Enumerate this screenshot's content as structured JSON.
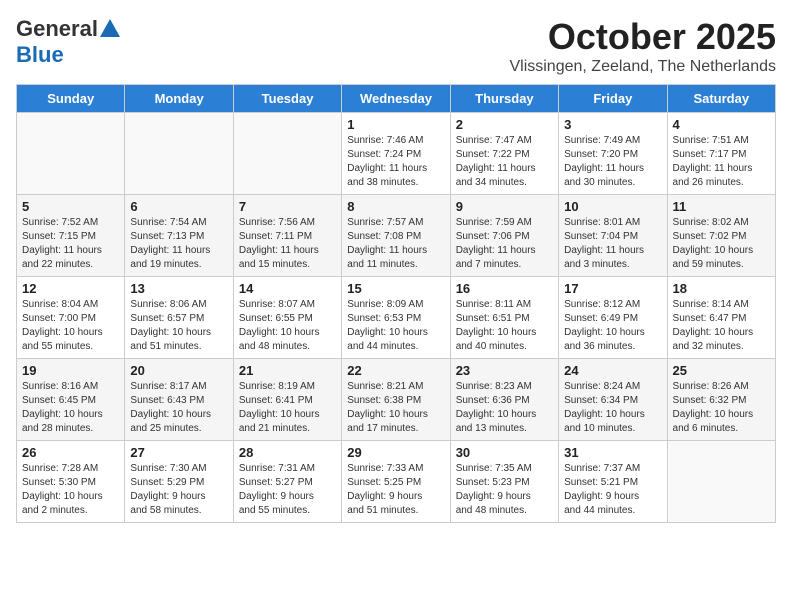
{
  "header": {
    "logo_general": "General",
    "logo_blue": "Blue",
    "month_title": "October 2025",
    "subtitle": "Vlissingen, Zeeland, The Netherlands"
  },
  "days_of_week": [
    "Sunday",
    "Monday",
    "Tuesday",
    "Wednesday",
    "Thursday",
    "Friday",
    "Saturday"
  ],
  "weeks": [
    [
      {
        "day": "",
        "info": ""
      },
      {
        "day": "",
        "info": ""
      },
      {
        "day": "",
        "info": ""
      },
      {
        "day": "1",
        "info": "Sunrise: 7:46 AM\nSunset: 7:24 PM\nDaylight: 11 hours\nand 38 minutes."
      },
      {
        "day": "2",
        "info": "Sunrise: 7:47 AM\nSunset: 7:22 PM\nDaylight: 11 hours\nand 34 minutes."
      },
      {
        "day": "3",
        "info": "Sunrise: 7:49 AM\nSunset: 7:20 PM\nDaylight: 11 hours\nand 30 minutes."
      },
      {
        "day": "4",
        "info": "Sunrise: 7:51 AM\nSunset: 7:17 PM\nDaylight: 11 hours\nand 26 minutes."
      }
    ],
    [
      {
        "day": "5",
        "info": "Sunrise: 7:52 AM\nSunset: 7:15 PM\nDaylight: 11 hours\nand 22 minutes."
      },
      {
        "day": "6",
        "info": "Sunrise: 7:54 AM\nSunset: 7:13 PM\nDaylight: 11 hours\nand 19 minutes."
      },
      {
        "day": "7",
        "info": "Sunrise: 7:56 AM\nSunset: 7:11 PM\nDaylight: 11 hours\nand 15 minutes."
      },
      {
        "day": "8",
        "info": "Sunrise: 7:57 AM\nSunset: 7:08 PM\nDaylight: 11 hours\nand 11 minutes."
      },
      {
        "day": "9",
        "info": "Sunrise: 7:59 AM\nSunset: 7:06 PM\nDaylight: 11 hours\nand 7 minutes."
      },
      {
        "day": "10",
        "info": "Sunrise: 8:01 AM\nSunset: 7:04 PM\nDaylight: 11 hours\nand 3 minutes."
      },
      {
        "day": "11",
        "info": "Sunrise: 8:02 AM\nSunset: 7:02 PM\nDaylight: 10 hours\nand 59 minutes."
      }
    ],
    [
      {
        "day": "12",
        "info": "Sunrise: 8:04 AM\nSunset: 7:00 PM\nDaylight: 10 hours\nand 55 minutes."
      },
      {
        "day": "13",
        "info": "Sunrise: 8:06 AM\nSunset: 6:57 PM\nDaylight: 10 hours\nand 51 minutes."
      },
      {
        "day": "14",
        "info": "Sunrise: 8:07 AM\nSunset: 6:55 PM\nDaylight: 10 hours\nand 48 minutes."
      },
      {
        "day": "15",
        "info": "Sunrise: 8:09 AM\nSunset: 6:53 PM\nDaylight: 10 hours\nand 44 minutes."
      },
      {
        "day": "16",
        "info": "Sunrise: 8:11 AM\nSunset: 6:51 PM\nDaylight: 10 hours\nand 40 minutes."
      },
      {
        "day": "17",
        "info": "Sunrise: 8:12 AM\nSunset: 6:49 PM\nDaylight: 10 hours\nand 36 minutes."
      },
      {
        "day": "18",
        "info": "Sunrise: 8:14 AM\nSunset: 6:47 PM\nDaylight: 10 hours\nand 32 minutes."
      }
    ],
    [
      {
        "day": "19",
        "info": "Sunrise: 8:16 AM\nSunset: 6:45 PM\nDaylight: 10 hours\nand 28 minutes."
      },
      {
        "day": "20",
        "info": "Sunrise: 8:17 AM\nSunset: 6:43 PM\nDaylight: 10 hours\nand 25 minutes."
      },
      {
        "day": "21",
        "info": "Sunrise: 8:19 AM\nSunset: 6:41 PM\nDaylight: 10 hours\nand 21 minutes."
      },
      {
        "day": "22",
        "info": "Sunrise: 8:21 AM\nSunset: 6:38 PM\nDaylight: 10 hours\nand 17 minutes."
      },
      {
        "day": "23",
        "info": "Sunrise: 8:23 AM\nSunset: 6:36 PM\nDaylight: 10 hours\nand 13 minutes."
      },
      {
        "day": "24",
        "info": "Sunrise: 8:24 AM\nSunset: 6:34 PM\nDaylight: 10 hours\nand 10 minutes."
      },
      {
        "day": "25",
        "info": "Sunrise: 8:26 AM\nSunset: 6:32 PM\nDaylight: 10 hours\nand 6 minutes."
      }
    ],
    [
      {
        "day": "26",
        "info": "Sunrise: 7:28 AM\nSunset: 5:30 PM\nDaylight: 10 hours\nand 2 minutes."
      },
      {
        "day": "27",
        "info": "Sunrise: 7:30 AM\nSunset: 5:29 PM\nDaylight: 9 hours\nand 58 minutes."
      },
      {
        "day": "28",
        "info": "Sunrise: 7:31 AM\nSunset: 5:27 PM\nDaylight: 9 hours\nand 55 minutes."
      },
      {
        "day": "29",
        "info": "Sunrise: 7:33 AM\nSunset: 5:25 PM\nDaylight: 9 hours\nand 51 minutes."
      },
      {
        "day": "30",
        "info": "Sunrise: 7:35 AM\nSunset: 5:23 PM\nDaylight: 9 hours\nand 48 minutes."
      },
      {
        "day": "31",
        "info": "Sunrise: 7:37 AM\nSunset: 5:21 PM\nDaylight: 9 hours\nand 44 minutes."
      },
      {
        "day": "",
        "info": ""
      }
    ]
  ]
}
